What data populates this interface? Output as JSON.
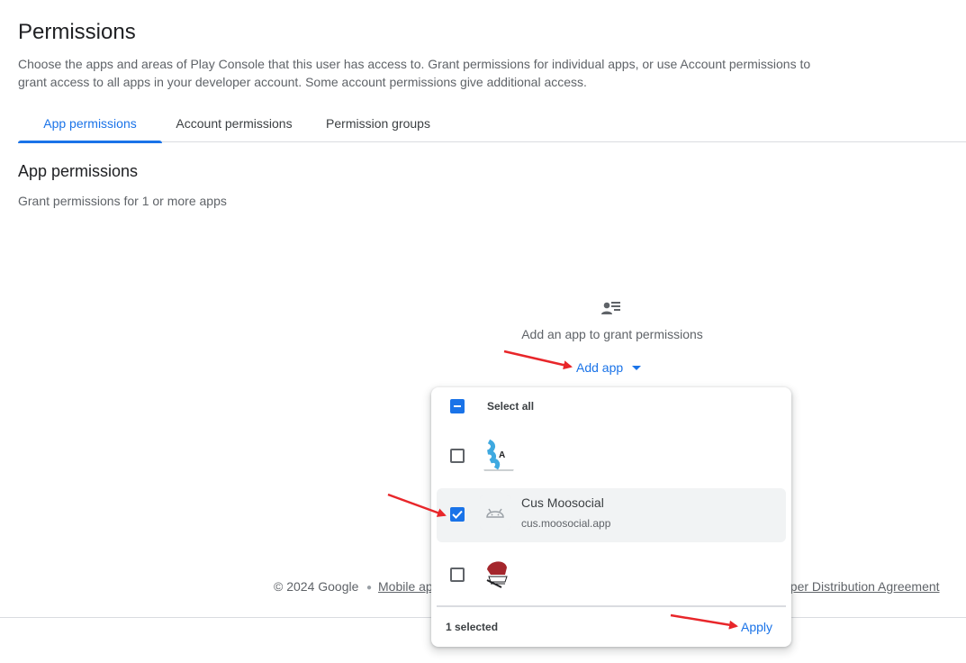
{
  "header": {
    "title": "Permissions",
    "description": "Choose the apps and areas of Play Console that this user has access to. Grant permissions for individual apps, or use Account permissions to grant access to all apps in your developer account. Some account permissions give additional access."
  },
  "tabs": [
    {
      "label": "App permissions",
      "active": true
    },
    {
      "label": "Account permissions",
      "active": false
    },
    {
      "label": "Permission groups",
      "active": false
    }
  ],
  "section": {
    "title": "App permissions",
    "subtitle": "Grant permissions for 1 or more apps"
  },
  "empty_state": {
    "icon": "person-list-icon",
    "text": "Add an app to grant permissions",
    "add_label": "Add app"
  },
  "dropdown": {
    "select_all_label": "Select all",
    "apps": [
      {
        "name": "",
        "package": "",
        "checked": false,
        "icon": "app-icon-blue"
      },
      {
        "name": "Cus Moosocial",
        "package": "cus.moosocial.app",
        "checked": true,
        "icon": "android-icon"
      },
      {
        "name": "",
        "package": "",
        "checked": false,
        "icon": "app-icon-red"
      }
    ],
    "selected_count": "1 selected",
    "apply_label": "Apply"
  },
  "footer": {
    "copyright": "© 2024 Google",
    "link1": "Mobile ap",
    "link2": "oper Distribution Agreement"
  },
  "colors": {
    "accent": "#1a73e8",
    "annotation_arrow": "#e8262a"
  }
}
